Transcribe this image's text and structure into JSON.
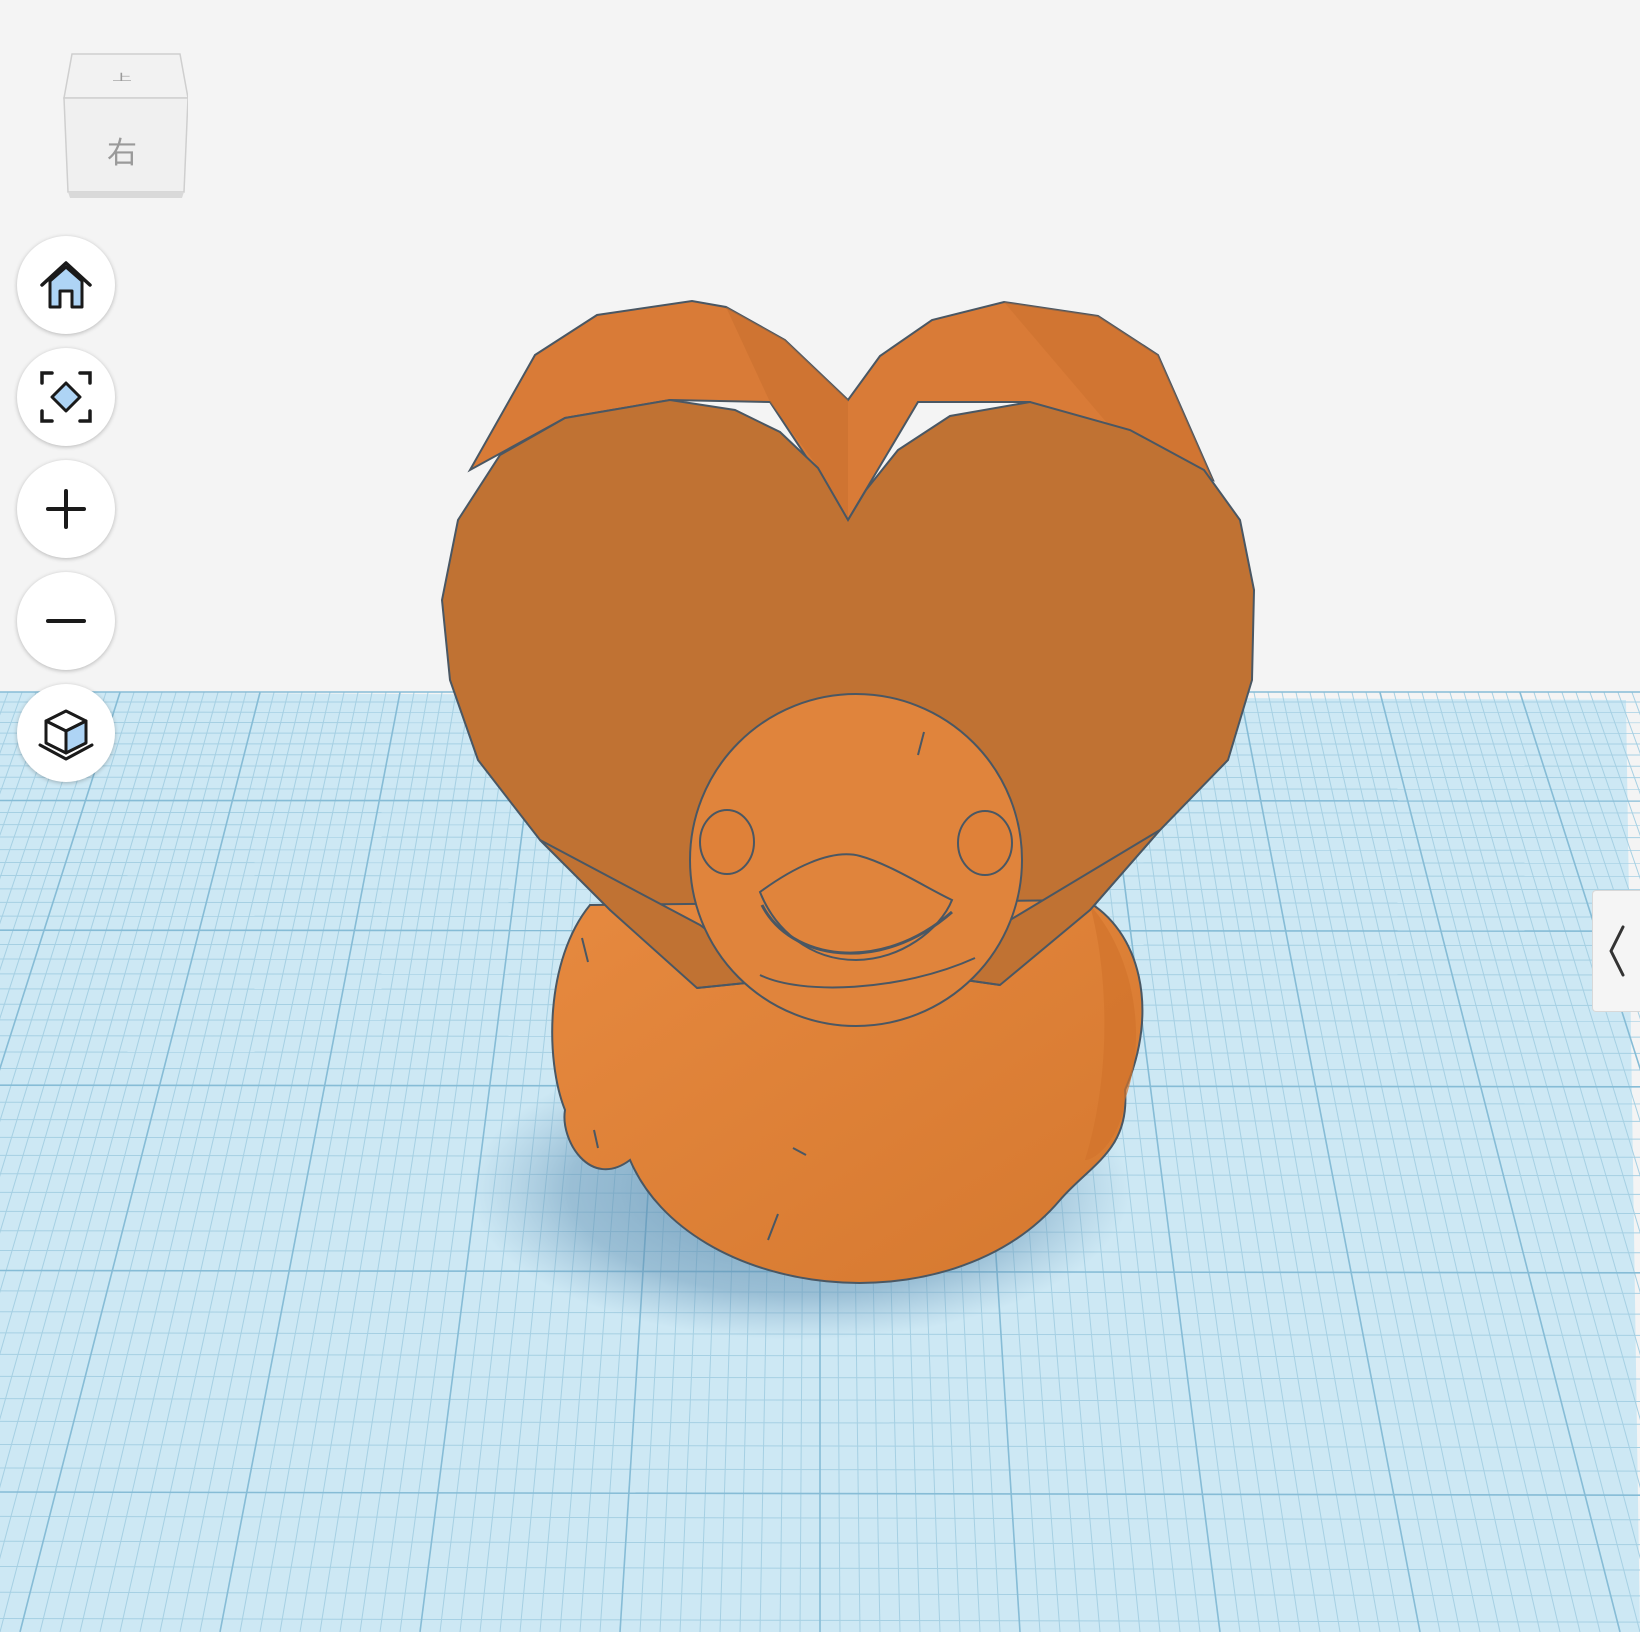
{
  "app": {
    "workplane_color": "#c9e6f2",
    "grid_minor_color": "#a8d2e4",
    "grid_major_color": "#86bfd8",
    "background_color": "#f4f4f4"
  },
  "view_cube": {
    "top_label": "上",
    "front_label": "右"
  },
  "toolbar": {
    "items": [
      {
        "name": "home-view",
        "icon": "home-icon"
      },
      {
        "name": "fit-all",
        "icon": "fit-view-icon"
      },
      {
        "name": "zoom-in",
        "icon": "plus-icon"
      },
      {
        "name": "zoom-out",
        "icon": "minus-icon"
      },
      {
        "name": "orthographic-view",
        "icon": "perspective-cube-icon"
      }
    ],
    "accent_color": "#aed4f5"
  },
  "scene": {
    "object_color": "#e0843c",
    "object_shadow_color": "#b8712f",
    "objects": [
      "heart",
      "duck-head",
      "duck-body"
    ]
  },
  "panel_toggle": {
    "icon": "chevron-left-icon"
  }
}
